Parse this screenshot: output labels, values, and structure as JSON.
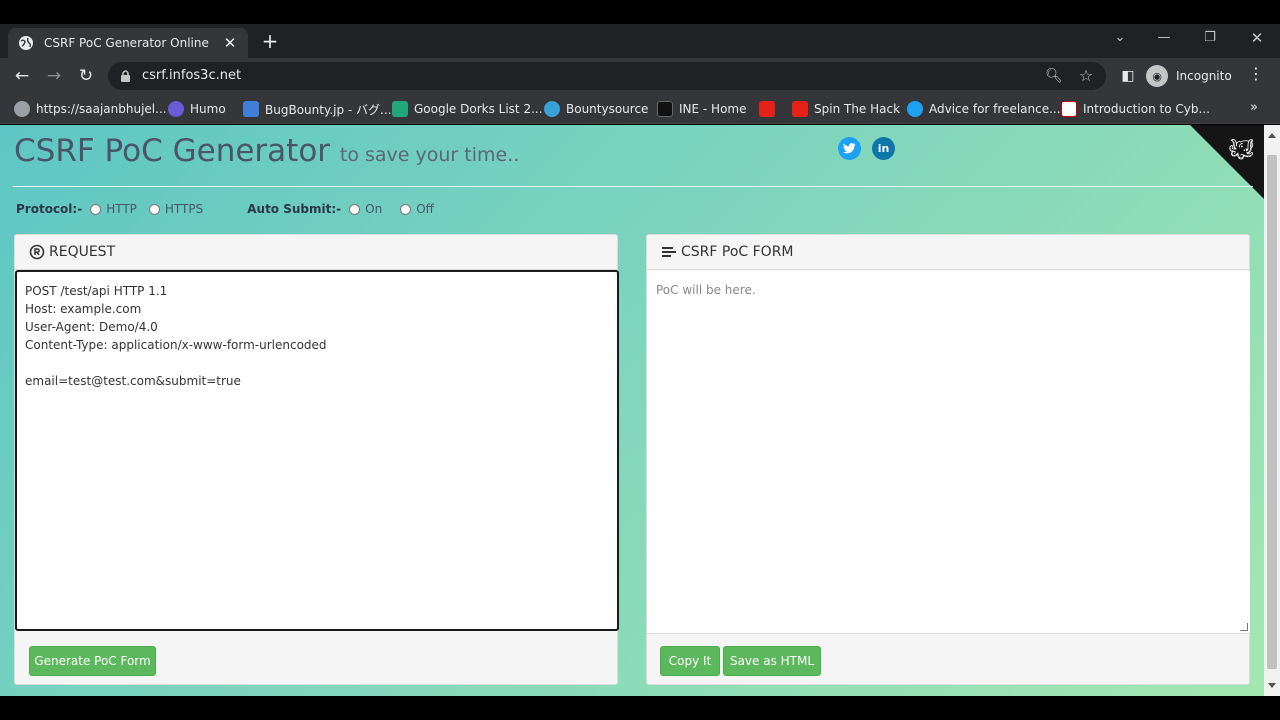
{
  "browser": {
    "tab_title": "CSRF PoC Generator Online",
    "url": "csrf.infos3c.net",
    "profile_label": "Incognito",
    "bookmarks": [
      {
        "label": "https://saajanbhujel...",
        "color": "#9aa0a6"
      },
      {
        "label": "Humo",
        "color": "#6b5bd6"
      },
      {
        "label": "BugBounty.jp - バグ...",
        "color": "#3f7fd6"
      },
      {
        "label": "Google Dorks List 2...",
        "color": "#1fa67a"
      },
      {
        "label": "Bountysource",
        "color": "#3aa0d8"
      },
      {
        "label": "INE - Home",
        "color": "#111111"
      },
      {
        "label": "",
        "color": "#e62117"
      },
      {
        "label": "Spin The Hack",
        "color": "#e62117"
      },
      {
        "label": "Advice for freelance...",
        "color": "#1da1f2"
      },
      {
        "label": "Introduction to Cyb...",
        "color": "#ffffff"
      }
    ]
  },
  "page": {
    "title": "CSRF PoC Generator",
    "subtitle": "to save your time..",
    "protocol_label": "Protocol:-",
    "protocol_options": [
      "HTTP",
      "HTTPS"
    ],
    "autosubmit_label": "Auto Submit:-",
    "autosubmit_options": [
      "On",
      "Off"
    ],
    "request_panel_title": "REQUEST",
    "request_text": "POST /test/api HTTP 1.1\nHost: example.com\nUser-Agent: Demo/4.0\nContent-Type: application/x-www-form-urlencoded\n\nemail=test@test.com&submit=true",
    "generate_button": "Generate PoC Form",
    "poc_panel_title": "CSRF PoC FORM",
    "poc_placeholder": "PoC will be here.",
    "copy_button": "Copy It",
    "save_button": "Save as HTML",
    "social": {
      "twitter_color": "#1da1f2",
      "linkedin_color": "#0e76a8"
    }
  }
}
